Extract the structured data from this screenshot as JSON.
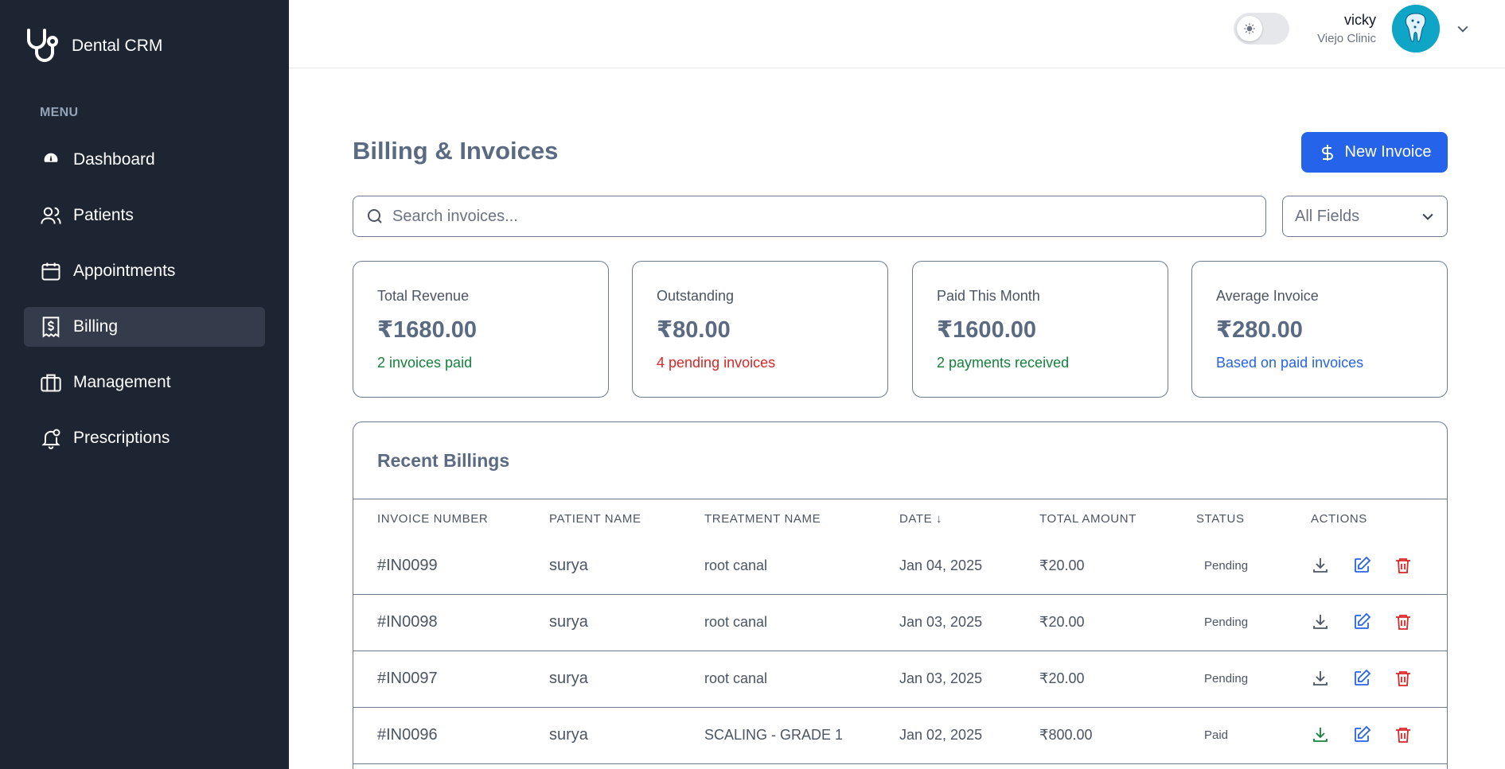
{
  "brand": {
    "name": "Dental CRM"
  },
  "sidebar": {
    "menu_label": "MENU",
    "items": [
      {
        "label": "Dashboard",
        "icon": "gauge-icon",
        "active": false
      },
      {
        "label": "Patients",
        "icon": "users-icon",
        "active": false
      },
      {
        "label": "Appointments",
        "icon": "calendar-icon",
        "active": false
      },
      {
        "label": "Billing",
        "icon": "receipt-icon",
        "active": true
      },
      {
        "label": "Management",
        "icon": "briefcase-icon",
        "active": false
      },
      {
        "label": "Prescriptions",
        "icon": "bell-icon",
        "active": false
      }
    ]
  },
  "header": {
    "user_name": "vicky",
    "clinic": "Viejo Clinic"
  },
  "page": {
    "title": "Billing & Invoices",
    "new_button": "New Invoice",
    "search_placeholder": "Search invoices...",
    "filter_value": "All Fields"
  },
  "stats": [
    {
      "label": "Total Revenue",
      "value": "₹1680.00",
      "sub": "2 invoices paid",
      "color": "#15803d"
    },
    {
      "label": "Outstanding",
      "value": "₹80.00",
      "sub": "4 pending invoices",
      "color": "#dc2626"
    },
    {
      "label": "Paid This Month",
      "value": "₹1600.00",
      "sub": "2 payments received",
      "color": "#15803d"
    },
    {
      "label": "Average Invoice",
      "value": "₹280.00",
      "sub": "Based on paid invoices",
      "color": "#2563eb"
    }
  ],
  "table": {
    "title": "Recent Billings",
    "columns": [
      "INVOICE NUMBER",
      "PATIENT NAME",
      "TREATMENT NAME",
      "DATE ↓",
      "TOTAL AMOUNT",
      "STATUS",
      "ACTIONS"
    ],
    "rows": [
      {
        "invoice": "#IN0099",
        "patient": "surya",
        "treatment": "root canal",
        "date": "Jan 04, 2025",
        "amount": "₹20.00",
        "status": "Pending"
      },
      {
        "invoice": "#IN0098",
        "patient": "surya",
        "treatment": "root canal",
        "date": "Jan 03, 2025",
        "amount": "₹20.00",
        "status": "Pending"
      },
      {
        "invoice": "#IN0097",
        "patient": "surya",
        "treatment": "root canal",
        "date": "Jan 03, 2025",
        "amount": "₹20.00",
        "status": "Pending"
      },
      {
        "invoice": "#IN0096",
        "patient": "surya",
        "treatment": "SCALING - GRADE 1",
        "date": "Jan 02, 2025",
        "amount": "₹800.00",
        "status": "Paid"
      }
    ]
  },
  "colors": {
    "sidebar_bg": "#1d2432",
    "accent": "#2563eb",
    "danger": "#dc2626",
    "success": "#15803d"
  }
}
